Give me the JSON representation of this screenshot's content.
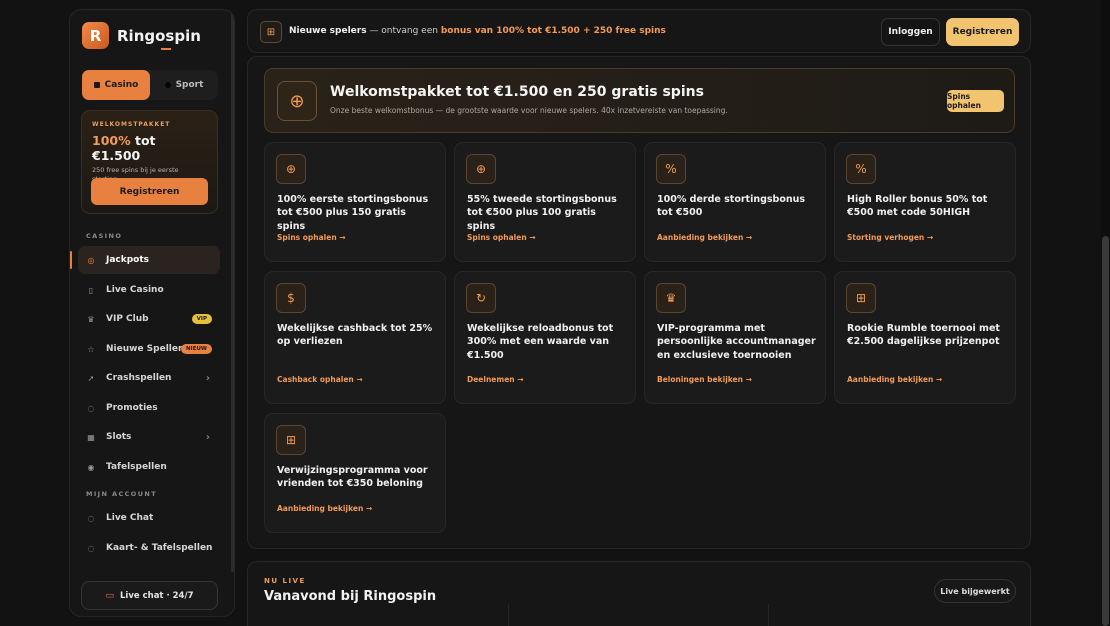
{
  "brand": {
    "logo_letter": "R",
    "name": "Ringospin"
  },
  "sidebar": {
    "segments": [
      {
        "label": "Casino"
      },
      {
        "label": "Sport"
      }
    ],
    "promo": {
      "kicker": "WELKOMSTPAKKET",
      "amount_pct": "100%",
      "amount_rest": "tot €1.500",
      "sub": "250 free spins bij je eerste storting",
      "button": "Registreren"
    },
    "section_casino": "CASINO",
    "items": [
      {
        "label": "Jackpots",
        "icon": "coins-icon"
      },
      {
        "label": "Live Casino",
        "icon": "card-icon"
      },
      {
        "label": "VIP Club",
        "icon": "crown-icon",
        "badge": "VIP"
      },
      {
        "label": "Nieuwe Spellen",
        "icon": "star-icon",
        "badge": "NIEUW"
      },
      {
        "label": "Crashspellen",
        "icon": "rocket-icon"
      },
      {
        "label": "Promoties",
        "icon": "tag-icon"
      },
      {
        "label": "Slots",
        "icon": "slots-icon"
      },
      {
        "label": "Tafelspellen",
        "icon": "eye-icon"
      }
    ],
    "section_account": "MIJN ACCOUNT",
    "account_items": [
      {
        "label": "Live Chat",
        "icon": "chat-icon"
      },
      {
        "label": "Kaart- & Tafelspellen",
        "icon": "chip-icon"
      }
    ],
    "chat_button": "Live chat · 24/7"
  },
  "topbar": {
    "announce_strong": "Nieuwe spelers",
    "announce_mid": " — ontvang een ",
    "announce_hl": "bonus van 100% tot €1.500 + 250 free spins",
    "login": "Inloggen",
    "register": "Registreren"
  },
  "hero": {
    "title": "Welkomstpakket tot €1.500 en 250 gratis spins",
    "subtitle": "Onze beste welkomstbonus — de grootste waarde voor nieuwe spelers. 40x inzetvereiste van toepassing.",
    "button": "Spins ophalen"
  },
  "cards": [
    {
      "icon": "roulette-icon",
      "title": "100% eerste stortingsbonus tot €500 plus 150 gratis spins",
      "link": "Spins ophalen →"
    },
    {
      "icon": "roulette-icon",
      "title": "55% tweede stortingsbonus tot €500 plus 100 gratis spins",
      "link": "Spins ophalen →"
    },
    {
      "icon": "percent-icon",
      "title": "100% derde stortingsbonus tot €500",
      "link": "Aanbieding bekijken →"
    },
    {
      "icon": "percent-icon",
      "title": "High Roller bonus 50% tot €500 met code 50HIGH",
      "link": "Storting verhogen →"
    },
    {
      "icon": "dollar-icon",
      "title": "Wekelijkse cashback tot 25% op verliezen",
      "link": "Cashback ophalen →"
    },
    {
      "icon": "reload-icon",
      "title": "Wekelijkse reloadbonus tot 300% met een waarde van €1.500",
      "link": "Deelnemen →"
    },
    {
      "icon": "crown-icon",
      "title": "VIP-programma met persoonlijke accountmanager en exclusieve toernooien",
      "link": "Beloningen bekijken →"
    },
    {
      "icon": "gift-icon",
      "title": "Rookie Rumble toernooi met €2.500 dagelijkse prijzenpot",
      "link": "Aanbieding bekijken →"
    },
    {
      "icon": "gift-icon",
      "title": "Verwijzingsprogramma voor vrienden tot €350 beloning",
      "link": "Aanbieding bekijken →"
    }
  ],
  "live": {
    "kicker": "NU LIVE",
    "title": "Vanavond bij Ringospin",
    "pill": "Live bijgewerkt"
  },
  "colors": {
    "accent": "#e88040",
    "gold": "#f3c470",
    "bg": "#121212"
  }
}
